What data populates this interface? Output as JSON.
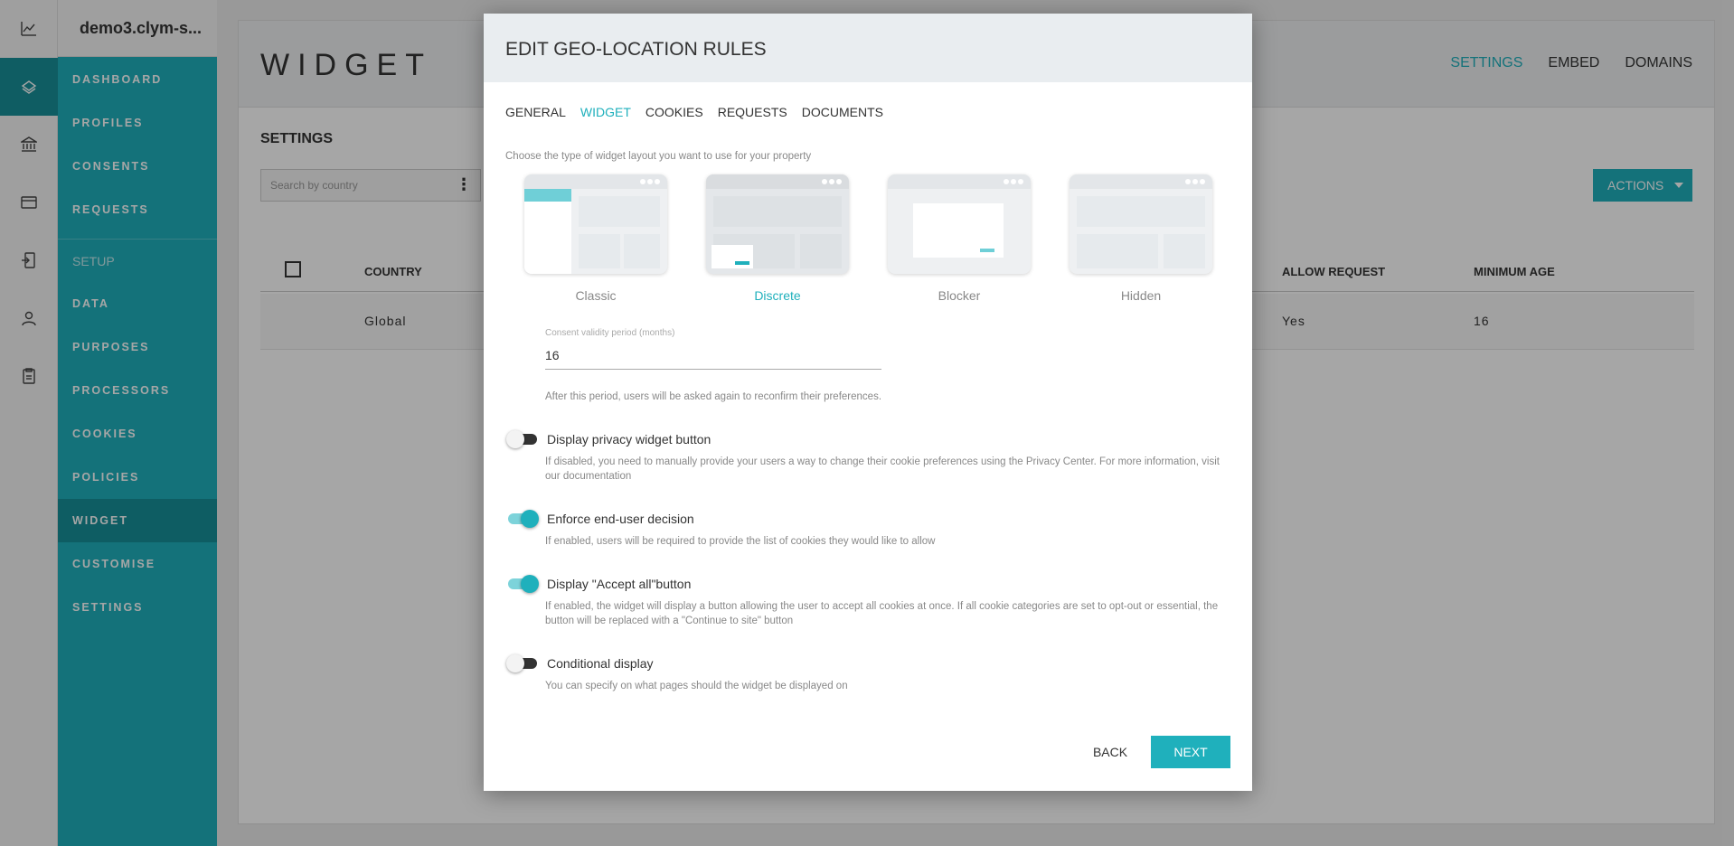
{
  "app": {
    "brand": "demo3.clym-s..."
  },
  "rail": {
    "icons": [
      "chart-icon",
      "layers-icon",
      "bank-icon",
      "card-icon",
      "login-icon",
      "user-icon",
      "clipboard-icon"
    ]
  },
  "sidebar": {
    "items": [
      {
        "label": "DASHBOARD"
      },
      {
        "label": "PROFILES"
      },
      {
        "label": "CONSENTS"
      },
      {
        "label": "REQUESTS"
      },
      {
        "label": "SETUP"
      },
      {
        "label": "DATA"
      },
      {
        "label": "PURPOSES"
      },
      {
        "label": "PROCESSORS"
      },
      {
        "label": "COOKIES"
      },
      {
        "label": "POLICIES"
      },
      {
        "label": "WIDGET"
      },
      {
        "label": "CUSTOMISE"
      },
      {
        "label": "SETTINGS"
      }
    ]
  },
  "main": {
    "title": "WIDGET",
    "links": [
      "SETTINGS",
      "EMBED",
      "DOMAINS"
    ],
    "section": "SETTINGS",
    "search_placeholder": "Search by country",
    "actions_label": "ACTIONS",
    "table": {
      "headers": [
        "COUNTRY",
        "ALLOW REQUEST",
        "MINIMUM AGE"
      ],
      "row": [
        "Global",
        "Yes",
        "16"
      ]
    }
  },
  "modal": {
    "title": "EDIT GEO-LOCATION RULES",
    "tabs": [
      "GENERAL",
      "WIDGET",
      "COOKIES",
      "REQUESTS",
      "DOCUMENTS"
    ],
    "active_tab": "WIDGET",
    "hint": "Choose the type of widget layout you want to use for your property",
    "layouts": [
      {
        "label": "Classic",
        "selected": false
      },
      {
        "label": "Discrete",
        "selected": true
      },
      {
        "label": "Blocker",
        "selected": false
      },
      {
        "label": "Hidden",
        "selected": false
      }
    ],
    "validity": {
      "label": "Consent validity period (months)",
      "value": "16",
      "help": "After this period, users will be asked again to reconfirm their preferences."
    },
    "toggles": [
      {
        "label": "Display privacy widget button",
        "on": false,
        "help": "If disabled, you need to manually provide your users a way to change their cookie preferences using the Privacy Center. For more information, visit our documentation"
      },
      {
        "label": "Enforce end-user decision",
        "on": true,
        "help": "If enabled, users will be required to provide the list of cookies they would like to allow"
      },
      {
        "label": "Display \"Accept all\"button",
        "on": true,
        "help": "If enabled, the widget will display a button allowing the user to accept all cookies at once. If all cookie categories are set to opt-out or essential, the button will be replaced with a \"Continue to site\" button"
      },
      {
        "label": "Conditional display",
        "on": false,
        "help": "You can specify on what pages should the widget be displayed on"
      }
    ],
    "back_label": "BACK",
    "next_label": "NEXT"
  },
  "colors": {
    "accent": "#1fb0bc",
    "sidebar": "#1fb0bc",
    "sidebar_active": "#168f99"
  }
}
